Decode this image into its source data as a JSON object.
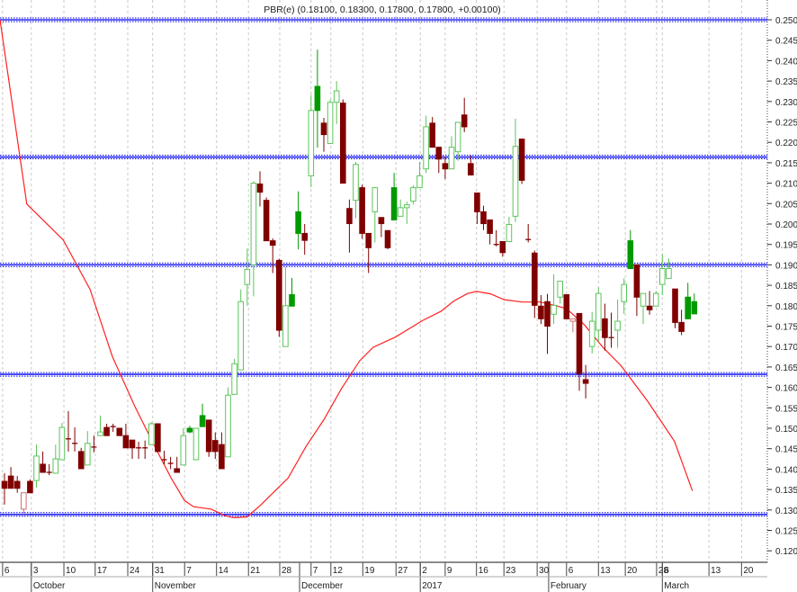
{
  "chart_data": {
    "type": "candlestick",
    "title": "PBR(e) (0.18100, 0.18300, 0.17800, 0.17800, +0.00100)",
    "ylim": [
      0.115,
      0.2545
    ],
    "xlim": [
      -0.7,
      119.5
    ],
    "y_ticks": [
      "0.120",
      "0.125",
      "0.130",
      "0.135",
      "0.140",
      "0.145",
      "0.150",
      "0.155",
      "0.160",
      "0.165",
      "0.170",
      "0.175",
      "0.180",
      "0.185",
      "0.190",
      "0.195",
      "0.200",
      "0.205",
      "0.210",
      "0.215",
      "0.220",
      "0.225",
      "0.230",
      "0.235",
      "0.240",
      "0.245",
      "0.250"
    ],
    "x_ticks": [
      {
        "label": "6",
        "i": -0.3
      },
      {
        "label": "3",
        "i": 4.2
      },
      {
        "label": "10",
        "i": 9.3
      },
      {
        "label": "17",
        "i": 14.2
      },
      {
        "label": "24",
        "i": 19.3
      },
      {
        "label": "31",
        "i": 23.2
      },
      {
        "label": "7",
        "i": 28.2
      },
      {
        "label": "14",
        "i": 33.2
      },
      {
        "label": "21",
        "i": 38.2
      },
      {
        "label": "28",
        "i": 43.1
      },
      {
        "label": "7",
        "i": 48
      },
      {
        "label": "12",
        "i": 51.1
      },
      {
        "label": "19",
        "i": 56.1
      },
      {
        "label": "27",
        "i": 61.3
      },
      {
        "label": "2",
        "i": 65.1
      },
      {
        "label": "9",
        "i": 69
      },
      {
        "label": "16",
        "i": 73.9
      },
      {
        "label": "23",
        "i": 78.2
      },
      {
        "label": "30",
        "i": 83.4
      },
      {
        "label": "6",
        "i": 88
      },
      {
        "label": "13",
        "i": 93
      },
      {
        "label": "20",
        "i": 97.2
      },
      {
        "label": "28",
        "i": 102.1
      },
      {
        "label": "6",
        "i": 103
      },
      {
        "label": "13",
        "i": 110.3
      },
      {
        "label": "20",
        "i": 115.4
      }
    ],
    "months": [
      {
        "label": "October",
        "i": 4.2
      },
      {
        "label": "November",
        "i": 23.2
      },
      {
        "label": "December",
        "i": 46.2
      },
      {
        "label": "2017",
        "i": 65.1
      },
      {
        "label": "February",
        "i": 85.2
      },
      {
        "label": "March",
        "i": 103
      }
    ],
    "horizontal_lines": [
      0.25,
      0.2164,
      0.19,
      0.1632,
      0.1289
    ],
    "moving_average": [
      [
        -0.7,
        0.25
      ],
      [
        3.5,
        0.2049
      ],
      [
        9.2,
        0.1961
      ],
      [
        13.4,
        0.184
      ],
      [
        16.9,
        0.1675
      ],
      [
        20.4,
        0.1554
      ],
      [
        23.9,
        0.1444
      ],
      [
        26.1,
        0.1378
      ],
      [
        28.2,
        0.1323
      ],
      [
        29.6,
        0.1308
      ],
      [
        32.4,
        0.1302
      ],
      [
        34.5,
        0.1286
      ],
      [
        35.9,
        0.1281
      ],
      [
        38,
        0.1283
      ],
      [
        40.1,
        0.1312
      ],
      [
        44.4,
        0.1378
      ],
      [
        47.2,
        0.1455
      ],
      [
        50,
        0.1521
      ],
      [
        52.8,
        0.1598
      ],
      [
        55.6,
        0.1665
      ],
      [
        57.7,
        0.1698
      ],
      [
        61.3,
        0.1724
      ],
      [
        65.5,
        0.1764
      ],
      [
        68.3,
        0.1786
      ],
      [
        70.4,
        0.1812
      ],
      [
        72.5,
        0.183
      ],
      [
        73.9,
        0.1835
      ],
      [
        76.1,
        0.1829
      ],
      [
        78.2,
        0.1815
      ],
      [
        81,
        0.1809
      ],
      [
        83.8,
        0.1809
      ],
      [
        85.9,
        0.1802
      ],
      [
        88,
        0.1793
      ],
      [
        90.8,
        0.1753
      ],
      [
        93.7,
        0.1698
      ],
      [
        96.5,
        0.1654
      ],
      [
        100.7,
        0.1566
      ],
      [
        104.9,
        0.1468
      ],
      [
        107.7,
        0.1347
      ]
    ],
    "candles": [
      [
        0,
        0.137,
        0.139,
        0.1313,
        0.1353,
        "sr"
      ],
      [
        1,
        0.1383,
        0.1405,
        0.1353,
        0.1353,
        "sr"
      ],
      [
        2,
        0.137,
        0.1383,
        0.1342,
        0.1353,
        "sr"
      ],
      [
        3,
        0.1302,
        0.1342,
        0.1285,
        0.1342,
        "hr"
      ],
      [
        4,
        0.137,
        0.1375,
        0.1342,
        0.1342,
        "sr"
      ],
      [
        5,
        0.1372,
        0.146,
        0.1355,
        0.1432,
        "hg"
      ],
      [
        6,
        0.1412,
        0.1443,
        0.1392,
        0.1392,
        "sr"
      ],
      [
        7,
        0.1392,
        0.1412,
        0.1385,
        0.1392,
        "x"
      ],
      [
        8,
        0.139,
        0.146,
        0.139,
        0.1425,
        "hg"
      ],
      [
        9,
        0.1423,
        0.1513,
        0.1423,
        0.1502,
        "hg"
      ],
      [
        10,
        0.1474,
        0.1542,
        0.1443,
        0.1474,
        "x"
      ],
      [
        11,
        0.1463,
        0.1502,
        0.1443,
        0.1463,
        "x"
      ],
      [
        12,
        0.1443,
        0.1452,
        0.1401,
        0.1401,
        "sr"
      ],
      [
        13,
        0.141,
        0.1493,
        0.141,
        0.1463,
        "hg"
      ],
      [
        14,
        0.1454,
        0.1482,
        0.1441,
        0.1454,
        "x"
      ],
      [
        15,
        0.1482,
        0.1531,
        0.1482,
        0.1491,
        "hg"
      ],
      [
        16,
        0.1502,
        0.1511,
        0.1482,
        0.1482,
        "sr"
      ],
      [
        17,
        0.1504,
        0.1511,
        0.1491,
        0.1504,
        "x"
      ],
      [
        18,
        0.15,
        0.15,
        0.1482,
        0.1482,
        "sr"
      ],
      [
        19,
        0.1482,
        0.1511,
        0.1452,
        0.1452,
        "sr"
      ],
      [
        20,
        0.1471,
        0.1471,
        0.1425,
        0.1452,
        "sr"
      ],
      [
        21,
        0.1452,
        0.1467,
        0.1425,
        0.1452,
        "x"
      ],
      [
        22,
        0.1452,
        0.147,
        0.1425,
        0.1452,
        "x"
      ],
      [
        23,
        0.146,
        0.1515,
        0.146,
        0.1511,
        "hg"
      ],
      [
        24,
        0.1511,
        0.1511,
        0.1443,
        0.1443,
        "sr"
      ],
      [
        25,
        0.1423,
        0.1445,
        0.1412,
        0.1423,
        "x"
      ],
      [
        26,
        0.1414,
        0.143,
        0.14,
        0.1414,
        "x"
      ],
      [
        27,
        0.1401,
        0.143,
        0.1392,
        0.1392,
        "sr"
      ],
      [
        28,
        0.141,
        0.15,
        0.141,
        0.1482,
        "hg"
      ],
      [
        29,
        0.15,
        0.1506,
        0.1488,
        0.1491,
        "sg"
      ],
      [
        30,
        0.1423,
        0.15,
        0.1423,
        0.15,
        "hg"
      ],
      [
        31,
        0.1531,
        0.156,
        0.1504,
        0.1504,
        "sg"
      ],
      [
        32,
        0.152,
        0.152,
        0.143,
        0.1443,
        "sr"
      ],
      [
        33,
        0.147,
        0.149,
        0.1425,
        0.1443,
        "sr"
      ],
      [
        34,
        0.146,
        0.149,
        0.1401,
        0.1401,
        "sr"
      ],
      [
        35,
        0.143,
        0.16,
        0.143,
        0.1581,
        "hg"
      ],
      [
        36,
        0.1583,
        0.167,
        0.1583,
        0.1658,
        "hg"
      ],
      [
        37,
        0.1643,
        0.184,
        0.1643,
        0.181,
        "hg"
      ],
      [
        38,
        0.1852,
        0.194,
        0.18,
        0.1889,
        "hg"
      ],
      [
        39,
        0.19,
        0.2105,
        0.1823,
        0.21,
        "hg"
      ],
      [
        40,
        0.2098,
        0.2129,
        0.2043,
        0.2078,
        "sr"
      ],
      [
        41,
        0.2058,
        0.2065,
        0.1959,
        0.1959,
        "sr"
      ],
      [
        42,
        0.1959,
        0.1965,
        0.188,
        0.1948,
        "sr"
      ],
      [
        43,
        0.1911,
        0.1915,
        0.1724,
        0.174,
        "sr"
      ],
      [
        44,
        0.17,
        0.1895,
        0.17,
        0.18,
        "hg"
      ],
      [
        45,
        0.1827,
        0.1868,
        0.1799,
        0.1799,
        "sg"
      ],
      [
        46,
        0.203,
        0.208,
        0.1938,
        0.1977,
        "sg"
      ],
      [
        47,
        0.1977,
        0.2,
        0.1925,
        0.196,
        "sr"
      ],
      [
        48,
        0.2118,
        0.2316,
        0.209,
        0.2278,
        "hg"
      ],
      [
        49,
        0.2337,
        0.2427,
        0.2187,
        0.2278,
        "sg"
      ],
      [
        50,
        0.2247,
        0.226,
        0.2177,
        0.2219,
        "sr"
      ],
      [
        51,
        0.2197,
        0.2305,
        0.2197,
        0.2298,
        "hg"
      ],
      [
        52,
        0.2298,
        0.235,
        0.2245,
        0.2326,
        "hg"
      ],
      [
        53,
        0.2296,
        0.2305,
        0.21,
        0.21,
        "sr"
      ],
      [
        54,
        0.2038,
        0.206,
        0.193,
        0.2001,
        "sr"
      ],
      [
        55,
        0.2058,
        0.2152,
        0.2014,
        0.2146,
        "hg"
      ],
      [
        56,
        0.2089,
        0.2096,
        0.1964,
        0.1977,
        "sr"
      ],
      [
        57,
        0.1977,
        0.1977,
        0.188,
        0.1942,
        "sr"
      ],
      [
        58,
        0.203,
        0.2089,
        0.1955,
        0.2089,
        "hg"
      ],
      [
        59,
        0.2016,
        0.2016,
        0.1968,
        0.2001,
        "sr"
      ],
      [
        60,
        0.1984,
        0.1984,
        0.1938,
        0.1942,
        "sr"
      ],
      [
        61,
        0.2089,
        0.2125,
        0.201,
        0.201,
        "sg"
      ],
      [
        62,
        0.2019,
        0.206,
        0.2019,
        0.204,
        "hg"
      ],
      [
        63,
        0.204,
        0.2055,
        0.2,
        0.2047,
        "hg"
      ],
      [
        64,
        0.2056,
        0.2095,
        0.2048,
        0.2089,
        "hg"
      ],
      [
        65,
        0.2089,
        0.2152,
        0.2089,
        0.2118,
        "hg"
      ],
      [
        66,
        0.2135,
        0.2265,
        0.2125,
        0.2238,
        "hg"
      ],
      [
        67,
        0.2247,
        0.2262,
        0.2188,
        0.2188,
        "sr"
      ],
      [
        68,
        0.2188,
        0.2188,
        0.2125,
        0.2159,
        "sr"
      ],
      [
        69,
        0.2148,
        0.2165,
        0.211,
        0.2135,
        "sr"
      ],
      [
        70,
        0.2135,
        0.2215,
        0.2135,
        0.2188,
        "hg"
      ],
      [
        71,
        0.2177,
        0.2249,
        0.2155,
        0.2249,
        "hg"
      ],
      [
        72,
        0.2267,
        0.2309,
        0.2225,
        0.2238,
        "sr"
      ],
      [
        73,
        0.2148,
        0.2168,
        0.212,
        0.212,
        "sr"
      ],
      [
        74,
        0.2076,
        0.2076,
        0.2,
        0.203,
        "sr"
      ],
      [
        75,
        0.203,
        0.2045,
        0.1985,
        0.2001,
        "sr"
      ],
      [
        76,
        0.201,
        0.201,
        0.195,
        0.1977,
        "sr"
      ],
      [
        77,
        0.195,
        0.1985,
        0.1945,
        0.195,
        "x"
      ],
      [
        78,
        0.1957,
        0.1957,
        0.192,
        0.193,
        "sr"
      ],
      [
        79,
        0.1957,
        0.2018,
        0.1957,
        0.1999,
        "hg"
      ],
      [
        80,
        0.2019,
        0.2258,
        0.2005,
        0.219,
        "hg"
      ],
      [
        81,
        0.2208,
        0.2208,
        0.2098,
        0.2107,
        "sr"
      ],
      [
        82,
        0.1962,
        0.2,
        0.1955,
        0.1962,
        "x"
      ],
      [
        83,
        0.1929,
        0.1935,
        0.177,
        0.1801,
        "sr"
      ],
      [
        84,
        0.1799,
        0.1826,
        0.1755,
        0.1768,
        "sr"
      ],
      [
        85,
        0.181,
        0.1829,
        0.1682,
        0.175,
        "sr"
      ],
      [
        86,
        0.1779,
        0.1877,
        0.1755,
        0.1801,
        "hg"
      ],
      [
        87,
        0.1821,
        0.186,
        0.1805,
        0.186,
        "hg"
      ],
      [
        88,
        0.1827,
        0.1827,
        0.1768,
        0.1768,
        "sr"
      ],
      [
        89,
        0.1762,
        0.1768,
        0.1735,
        0.1768,
        "hr"
      ],
      [
        90,
        0.1781,
        0.1781,
        0.1592,
        0.1634,
        "sr"
      ],
      [
        91,
        0.1619,
        0.1655,
        0.1573,
        0.161,
        "sr"
      ],
      [
        92,
        0.17,
        0.1785,
        0.1683,
        0.1762,
        "hg"
      ],
      [
        93,
        0.174,
        0.1845,
        0.1712,
        0.183,
        "hg"
      ],
      [
        94,
        0.1768,
        0.1805,
        0.169,
        0.1722,
        "sr"
      ],
      [
        95,
        0.1722,
        0.1783,
        0.1697,
        0.1722,
        "x"
      ],
      [
        96,
        0.174,
        0.1815,
        0.1697,
        0.1762,
        "hg"
      ],
      [
        97,
        0.181,
        0.1867,
        0.178,
        0.1852,
        "hg"
      ],
      [
        98,
        0.1959,
        0.1985,
        0.1891,
        0.1891,
        "sg"
      ],
      [
        99,
        0.19,
        0.19,
        0.1775,
        0.1821,
        "sr"
      ],
      [
        100,
        0.1799,
        0.183,
        0.1755,
        0.183,
        "hg"
      ],
      [
        101,
        0.1799,
        0.1836,
        0.1778,
        0.179,
        "sr"
      ],
      [
        102,
        0.1799,
        0.1836,
        0.1799,
        0.183,
        "hg"
      ],
      [
        103,
        0.1852,
        0.1927,
        0.1826,
        0.1891,
        "hg"
      ],
      [
        104,
        0.1867,
        0.1916,
        0.1867,
        0.1891,
        "hg"
      ],
      [
        105,
        0.1841,
        0.1841,
        0.1745,
        0.1759,
        "sr"
      ],
      [
        106,
        0.1759,
        0.179,
        0.1728,
        0.1737,
        "sr"
      ],
      [
        107,
        0.1821,
        0.1856,
        0.1768,
        0.1768,
        "sg"
      ],
      [
        108,
        0.181,
        0.183,
        0.178,
        0.178,
        "sg"
      ]
    ],
    "colors": {
      "hollow_green": "#5cc45c",
      "solid_green": "#009a00",
      "red": "#800000",
      "hollow_red": "#d07070",
      "ma": "#ff2020",
      "level": "#0000ee",
      "grid": "#c8c8c8"
    }
  }
}
